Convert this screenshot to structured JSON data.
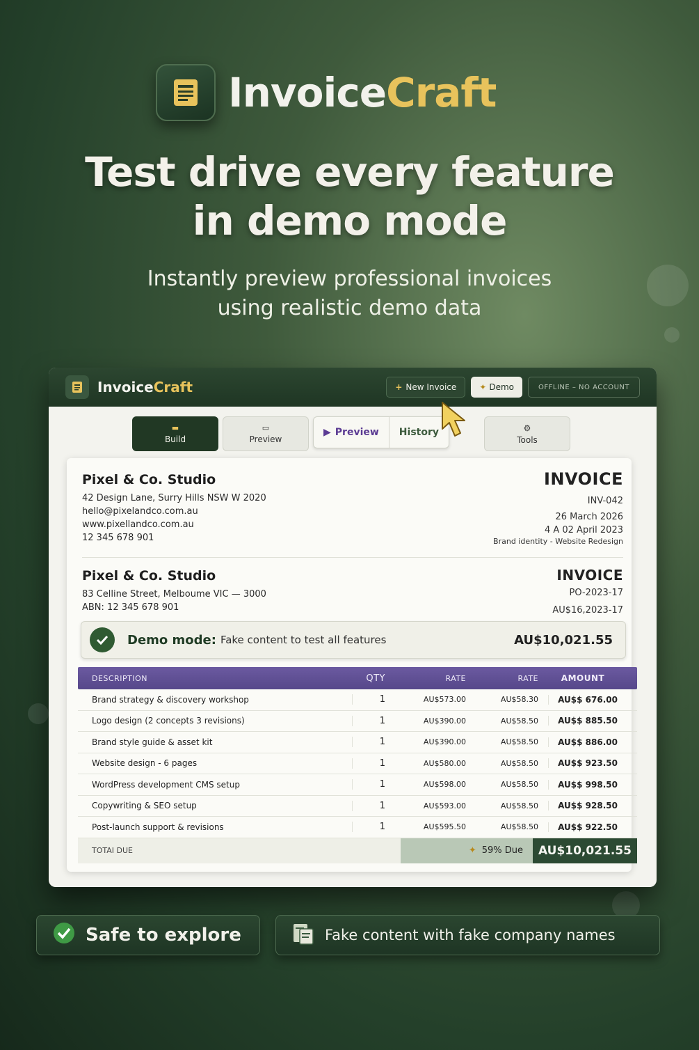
{
  "brand": {
    "name_part1": "Invoice",
    "name_part2": "Craft"
  },
  "hero": {
    "headline_line1": "Test drive every feature",
    "headline_line2": "in demo mode",
    "sub_line1": "Instantly preview professional invoices",
    "sub_line2": "using realistic demo data"
  },
  "app": {
    "title_part1": "Invoice",
    "title_part2": "Craft",
    "new_invoice_label": "New Invoice",
    "demo_label": "Demo",
    "status_label": "OFFLINE – NO ACCOUNT",
    "tabs": {
      "build": "Build",
      "preview": "Preview",
      "seg_preview": "Preview",
      "seg_history": "History",
      "tools": "Tools"
    }
  },
  "invoice": {
    "from": {
      "company": "Pixel & Co. Studio",
      "address": "42 Design Lane, Surry Hills NSW W 2020",
      "email": "hello@pixelandco.com.au",
      "website": "www.pixellandco.com.au",
      "phone": "12 345 678 901"
    },
    "header": {
      "title": "INVOICE",
      "number": "INV-042",
      "date": "26 March 2026",
      "due_date": "4 A 02 April 2023",
      "project": "Brand identity - Website Redesign"
    },
    "to": {
      "company": "Pixel & Co. Studio",
      "address": "83 Celline Street, Melboume VIC — 3000",
      "abn": "ABN: 12 345 678 901"
    },
    "header2": {
      "title": "INVOICE",
      "po": "PO-2023-17",
      "ref": "AU$16,2023-17"
    },
    "demo_banner": {
      "strong": "Demo mode:",
      "text": "Fake content to test all features",
      "amount": "AU$10,021.55"
    },
    "columns": [
      "DESCRIPTION",
      "QTY",
      "RATE",
      "RATE",
      "AMOUNT"
    ],
    "rows": [
      {
        "desc": "Brand strategy & discovery workshop",
        "qty": "1",
        "rate1": "AU$573.00",
        "rate2": "AU$58.30",
        "amount": "AU$$ 676.00"
      },
      {
        "desc": "Logo design (2 concepts 3 revisions)",
        "qty": "1",
        "rate1": "AU$390.00",
        "rate2": "AU$58.50",
        "amount": "AU$$ 885.50"
      },
      {
        "desc": "Brand style guide & asset kit",
        "qty": "1",
        "rate1": "AU$390.00",
        "rate2": "AU$58.50",
        "amount": "AU$$ 886.00"
      },
      {
        "desc": "Website design - 6 pages",
        "qty": "1",
        "rate1": "AU$580.00",
        "rate2": "AU$58.50",
        "amount": "AU$$ 923.50"
      },
      {
        "desc": "WordPress development CMS setup",
        "qty": "1",
        "rate1": "AU$598.00",
        "rate2": "AU$58.50",
        "amount": "AU$$ 998.50"
      },
      {
        "desc": "Copywriting & SEO setup",
        "qty": "1",
        "rate1": "AU$593.00",
        "rate2": "AU$58.50",
        "amount": "AU$$ 928.50"
      },
      {
        "desc": "Post-launch support & revisions",
        "qty": "1",
        "rate1": "AU$595.50",
        "rate2": "AU$58.50",
        "amount": "AU$$ 922.50"
      }
    ],
    "total": {
      "label": "TOTAI DUE",
      "due": "59% Due",
      "amount": "AU$10,021.55"
    }
  },
  "pills": {
    "safe": "Safe to explore",
    "fake": "Fake content with fake company names"
  },
  "colors": {
    "brand_gold": "#e8c35c",
    "dark_green": "#213824",
    "purple_header": "#5b4a8e",
    "accent_purple_text": "#5b3b93"
  }
}
